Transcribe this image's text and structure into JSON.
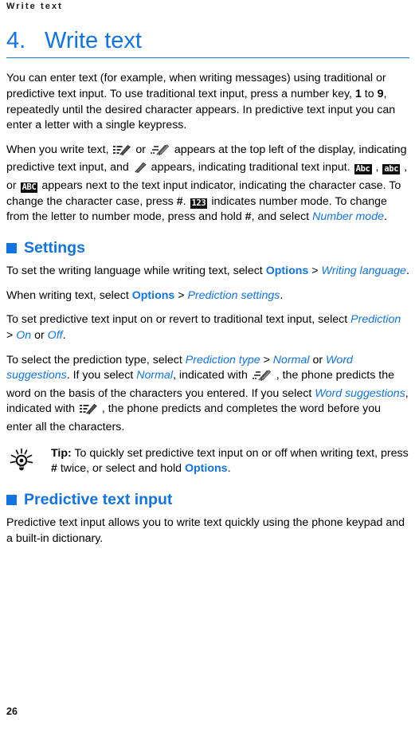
{
  "document": {
    "running_header": "Write text",
    "page_number": "26",
    "accent_color": "#1273e2",
    "text_color": "#000000"
  },
  "chapter": {
    "number": "4.",
    "title": "Write text"
  },
  "intro": {
    "p1_a": "You can enter text (for example, when writing messages) using traditional or predictive text input. To use traditional text input, press a number key, ",
    "p1_key1": "1",
    "p1_b": " to ",
    "p1_key2": "9",
    "p1_c": ", repeatedly until the desired character appears. In predictive text input you can enter a letter with a single keypress.",
    "p2_a": "When you write text, ",
    "p2_icon1": "pencil-lines-icon",
    "p2_b": " or ",
    "p2_icon2": "pencil-dotted-icon",
    "p2_c": " appears at the top left of the display, indicating predictive text input, and ",
    "p2_icon3": "pencil-icon",
    "p2_d": " appears, indicating traditional text input. ",
    "p2_badge1": "Abc",
    "p2_e": " , ",
    "p2_badge2": "abc",
    "p2_f": " , or ",
    "p2_badge3": "ABC",
    "p2_g": " appears next to the text input indicator, indicating the character case. To change the character case, press ",
    "p2_hash": "#",
    "p2_h": ". ",
    "p2_badge4": "123",
    "p2_i": " indicates number mode. To change from the letter to number mode, press and hold ",
    "p2_hash2": "#",
    "p2_j": ", and select ",
    "p2_link": "Number mode",
    "p2_k": "."
  },
  "settings": {
    "heading": "Settings",
    "p1_a": "To set the writing language while writing text, select ",
    "p1_options": "Options",
    "p1_sep": " > ",
    "p1_target": "Writing language",
    "p1_end": ".",
    "p2_a": "When writing text, select ",
    "p2_options": "Options",
    "p2_sep": " > ",
    "p2_target": "Prediction settings",
    "p2_end": ".",
    "p3_a": "To set predictive text input on or revert to traditional text input, select ",
    "p3_prediction": "Prediction",
    "p3_sep": " > ",
    "p3_on": "On",
    "p3_or": " or ",
    "p3_off": "Off",
    "p3_end": ".",
    "p4_a": "To select the prediction type, select ",
    "p4_type": "Prediction type",
    "p4_sep": " > ",
    "p4_normal": "Normal",
    "p4_or": " or ",
    "p4_word": "Word suggestions",
    "p4_b": ". If you select ",
    "p4_normal2": "Normal",
    "p4_c": ", indicated with ",
    "p4_icon1": "pencil-dotted-icon",
    "p4_d": " , the phone predicts the word on the basis of the characters you entered. If you select ",
    "p4_word2": "Word suggestions",
    "p4_e": ", indicated with ",
    "p4_icon2": "pencil-lines-icon",
    "p4_f": " , the phone predicts and completes the word before you enter all the characters."
  },
  "tip": {
    "icon": "lightbulb-icon",
    "label": "Tip:",
    "text_a": " To quickly set predictive text input on or off when writing text, press ",
    "key": "#",
    "text_b": " twice, or select and hold ",
    "options": "Options",
    "text_c": "."
  },
  "predictive": {
    "heading": "Predictive text input",
    "p1": "Predictive text input allows you to write text quickly using the phone keypad and a built-in dictionary."
  }
}
